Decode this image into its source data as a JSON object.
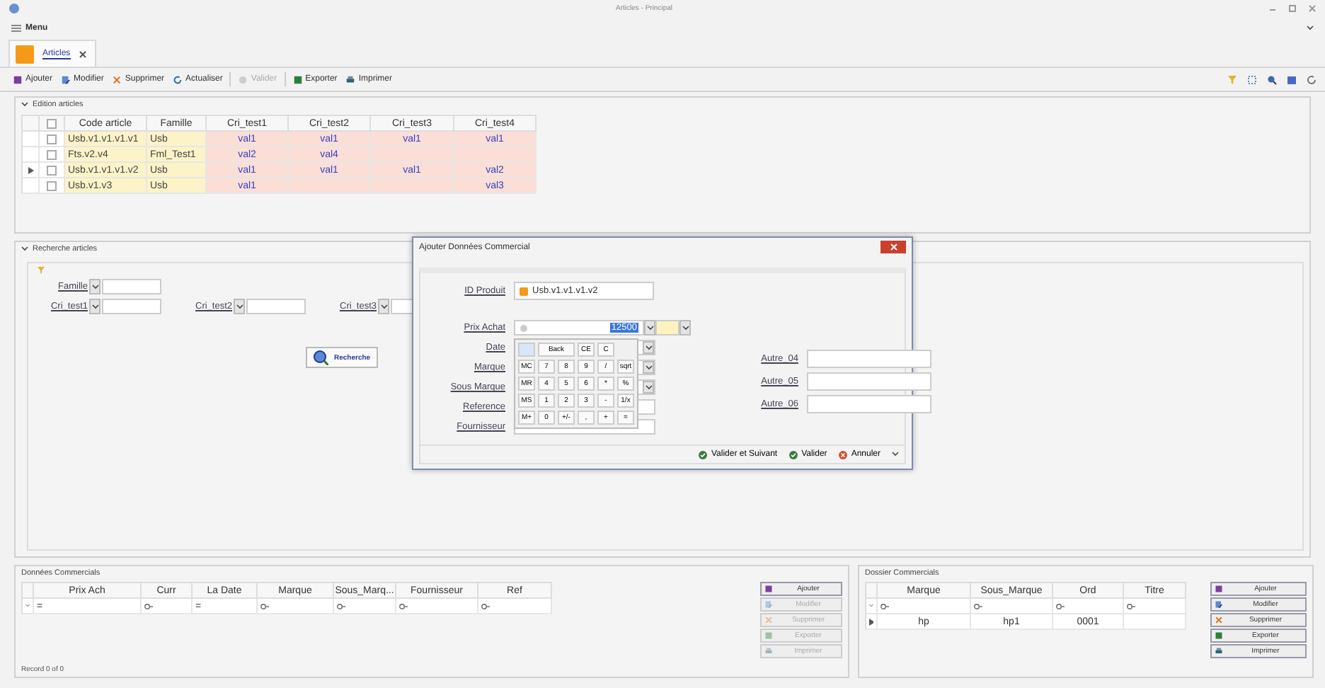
{
  "window": {
    "title": "Articles - Principal"
  },
  "menu": {
    "label": "Menu"
  },
  "doc_tabs": [
    {
      "label": "Articles",
      "selected": true
    }
  ],
  "toolbar": [
    {
      "label": "Ajouter",
      "kind": "add",
      "disabled": false
    },
    {
      "label": "Modifier",
      "kind": "edit",
      "disabled": false
    },
    {
      "label": "Supprimer",
      "kind": "delete",
      "disabled": false
    },
    {
      "label": "Actualiser",
      "kind": "refresh",
      "disabled": false
    },
    {
      "label": "Valider",
      "kind": "validate",
      "disabled": true
    },
    {
      "label": "Exporter",
      "kind": "export",
      "disabled": false
    },
    {
      "label": "Imprimer",
      "kind": "print",
      "disabled": false
    }
  ],
  "edition": {
    "title": "Edition articles",
    "all_checked": false,
    "columns": [
      "Code article",
      "Famille",
      "Cri_test1",
      "Cri_test2",
      "Cri_test3",
      "Cri_test4"
    ],
    "rows": [
      {
        "checked": false,
        "current": false,
        "cells": [
          "Usb.v1.v1.v1.v1",
          "Usb",
          "val1",
          "val1",
          "val1",
          "val1"
        ]
      },
      {
        "checked": false,
        "current": false,
        "cells": [
          "Fts.v2.v4",
          "Fml_Test1",
          "val2",
          "val4",
          null,
          null
        ]
      },
      {
        "checked": false,
        "current": true,
        "cells": [
          "Usb.v1.v1.v1.v2",
          "Usb",
          "val1",
          "val1",
          "val1",
          "val2"
        ]
      },
      {
        "checked": false,
        "current": false,
        "cells": [
          "Usb.v1.v3",
          "Usb",
          "val1",
          null,
          null,
          "val3"
        ]
      }
    ]
  },
  "search": {
    "title": "Recherche articles",
    "rows": [
      [
        {
          "label": "Famille"
        }
      ],
      [
        {
          "label": "Cri_test1"
        },
        {
          "label": "Cri_test2"
        },
        {
          "label": "Cri_test3"
        }
      ]
    ],
    "button": "Recherche"
  },
  "dialog": {
    "title": "Ajouter Données Commercial",
    "id_label": "ID Produit",
    "id_value": "Usb.v1.v1.v1.v2",
    "fields": [
      {
        "label": "Prix Achat",
        "kind": "calc",
        "value": "12500",
        "highlighted": true
      },
      {
        "label": "Date",
        "kind": "combo"
      },
      {
        "label": "Marque",
        "kind": "combo"
      },
      {
        "label": "Sous Marque",
        "kind": "combo"
      },
      {
        "label": "Reference",
        "kind": "text"
      },
      {
        "label": "Fournisseur",
        "kind": "text"
      }
    ],
    "other_fields": [
      "Autre_04",
      "Autre_05",
      "Autre_06"
    ],
    "calculator": {
      "top": [
        "Back",
        "CE",
        "C"
      ],
      "memory": [
        "MC",
        "MR",
        "MS",
        "M+"
      ],
      "rows": [
        [
          "7",
          "8",
          "9",
          "/",
          "sqrt"
        ],
        [
          "4",
          "5",
          "6",
          "*",
          "%"
        ],
        [
          "1",
          "2",
          "3",
          "-",
          "1/x"
        ],
        [
          "0",
          "+/-",
          ",",
          "+",
          "="
        ]
      ]
    },
    "buttons": [
      {
        "label": "Valider et Suivant",
        "kind": "ok"
      },
      {
        "label": "Valider",
        "kind": "ok"
      },
      {
        "label": "Annuler",
        "kind": "cancel"
      }
    ]
  },
  "commercial_data": {
    "title": "Données Commercials",
    "columns": [
      "Prix Ach",
      "Curr",
      "La Date",
      "Marque",
      "Sous_Marq...",
      "Fournisseur",
      "Ref"
    ],
    "filter": [
      {
        "kind": "text",
        "text": "="
      },
      {
        "kind": "icon"
      },
      {
        "kind": "text",
        "text": "="
      },
      {
        "kind": "icon"
      },
      {
        "kind": "icon"
      },
      {
        "kind": "icon"
      },
      {
        "kind": "icon"
      }
    ],
    "navigator": "Record 0 of 0",
    "buttons": [
      {
        "label": "Ajouter",
        "kind": "add",
        "disabled": false
      },
      {
        "label": "Modifier",
        "kind": "edit",
        "disabled": true
      },
      {
        "label": "Supprimer",
        "kind": "delete",
        "disabled": true
      },
      {
        "label": "Exporter",
        "kind": "export",
        "disabled": true
      },
      {
        "label": "Imprimer",
        "kind": "print",
        "disabled": true
      }
    ]
  },
  "commercial_file": {
    "title": "Dossier Commercials",
    "columns": [
      "Marque",
      "Sous_Marque",
      "Ord",
      "Titre"
    ],
    "filter": [
      {
        "kind": "icon"
      },
      {
        "kind": "icon"
      },
      {
        "kind": "icon"
      },
      {
        "kind": "icon"
      }
    ],
    "rows": [
      {
        "cells": [
          "hp",
          "hp1",
          "0001",
          null
        ]
      }
    ],
    "buttons": [
      {
        "label": "Ajouter",
        "kind": "add",
        "disabled": false
      },
      {
        "label": "Modifier",
        "kind": "edit",
        "disabled": false
      },
      {
        "label": "Supprimer",
        "kind": "delete",
        "disabled": false
      },
      {
        "label": "Exporter",
        "kind": "export",
        "disabled": false
      },
      {
        "label": "Imprimer",
        "kind": "print",
        "disabled": false
      }
    ]
  }
}
